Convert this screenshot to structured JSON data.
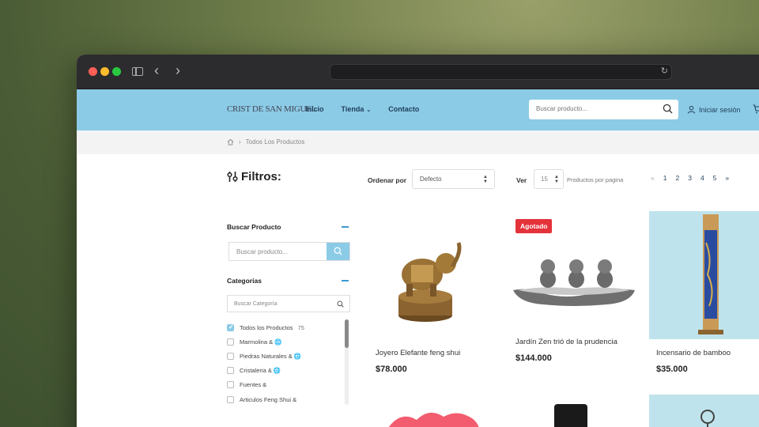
{
  "header": {
    "logo": "CRIST DE SAN MIGUEL",
    "menu": [
      {
        "label": "Inicio"
      },
      {
        "label": "Tienda"
      },
      {
        "label": "Contacto"
      }
    ],
    "search_placeholder": "Buscar producto...",
    "login_label": "Iniciar sesión"
  },
  "breadcrumb": {
    "current": "Todos Los Productos"
  },
  "toolbar": {
    "filters_title": "Filtros:",
    "sort_label": "Ordenar por",
    "sort_value": "Defecto",
    "view_label": "Ver",
    "view_value": "15",
    "per_page_label": "Productos por pagina",
    "pages": [
      "«",
      "1",
      "2",
      "3",
      "4",
      "5",
      "»"
    ]
  },
  "sidebar": {
    "product_search_title": "Buscar Producto",
    "product_search_placeholder": "Buscar producto...",
    "categories_title": "Categorias",
    "category_search_placeholder": "Buscar Categoría",
    "categories": [
      {
        "label": "Todos los Productos",
        "count": "75",
        "checked": true
      },
      {
        "label": "Marmolina & 🌐",
        "count": "",
        "checked": false
      },
      {
        "label": "Piedras Naturales & 🌐",
        "count": "",
        "checked": false
      },
      {
        "label": "Cristaleria & 🌐",
        "count": "",
        "checked": false
      },
      {
        "label": "Fuentes &",
        "count": "",
        "checked": false
      },
      {
        "label": "Articulos Feng Shui &",
        "count": "",
        "checked": false
      }
    ]
  },
  "products": [
    {
      "name": "Joyero Elefante feng shui",
      "price": "$78.000",
      "badge": ""
    },
    {
      "name": "Jardín Zen trió de la prudencia",
      "price": "$144.000",
      "badge": "Agotado"
    },
    {
      "name": "Incensario de bamboo",
      "price": "$35.000",
      "badge": ""
    }
  ],
  "colors": {
    "header_bg": "#8bcbe6",
    "accent": "#3a9ad1",
    "badge_red": "#e4323b"
  }
}
